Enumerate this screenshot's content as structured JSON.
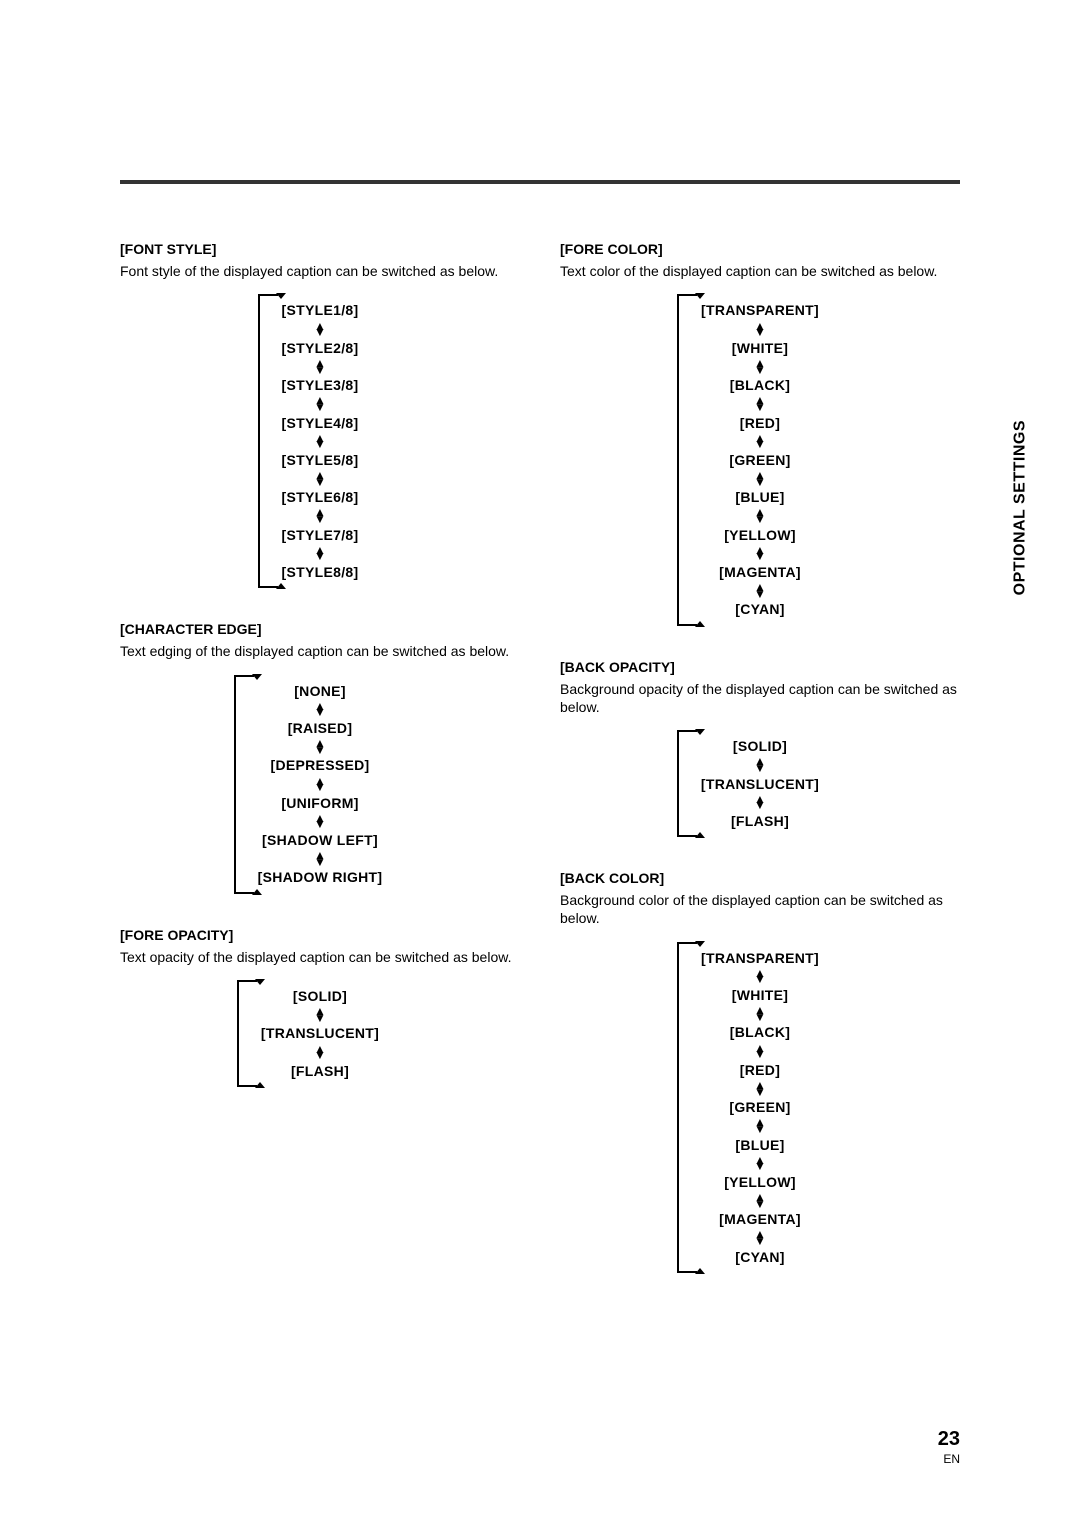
{
  "side_label": "OPTIONAL SETTINGS",
  "page_number": "23",
  "lang": "EN",
  "left": [
    {
      "title": "[FONT STYLE]",
      "desc": "Font style of the displayed caption can be switched as below.",
      "options": [
        "[STYLE1/8]",
        "[STYLE2/8]",
        "[STYLE3/8]",
        "[STYLE4/8]",
        "[STYLE5/8]",
        "[STYLE6/8]",
        "[STYLE7/8]",
        "[STYLE8/8]"
      ]
    },
    {
      "title": "[CHARACTER EDGE]",
      "desc": "Text edging of the displayed caption can be switched as below.",
      "options": [
        "[NONE]",
        "[RAISED]",
        "[DEPRESSED]",
        "[UNIFORM]",
        "[SHADOW LEFT]",
        "[SHADOW RIGHT]"
      ]
    },
    {
      "title": "[FORE OPACITY]",
      "desc": "Text opacity of the displayed caption can be switched as below.",
      "options": [
        "[SOLID]",
        "[TRANSLUCENT]",
        "[FLASH]"
      ]
    }
  ],
  "right": [
    {
      "title": "[FORE COLOR]",
      "desc": "Text color of the displayed caption can be switched as below.",
      "options": [
        "[TRANSPARENT]",
        "[WHITE]",
        "[BLACK]",
        "[RED]",
        "[GREEN]",
        "[BLUE]",
        "[YELLOW]",
        "[MAGENTA]",
        "[CYAN]"
      ]
    },
    {
      "title": "[BACK OPACITY]",
      "desc": "Background opacity of the displayed caption can be switched as below.",
      "options": [
        "[SOLID]",
        "[TRANSLUCENT]",
        "[FLASH]"
      ]
    },
    {
      "title": "[BACK COLOR]",
      "desc": "Background color of the displayed caption can be switched as below.",
      "options": [
        "[TRANSPARENT]",
        "[WHITE]",
        "[BLACK]",
        "[RED]",
        "[GREEN]",
        "[BLUE]",
        "[YELLOW]",
        "[MAGENTA]",
        "[CYAN]"
      ]
    }
  ]
}
